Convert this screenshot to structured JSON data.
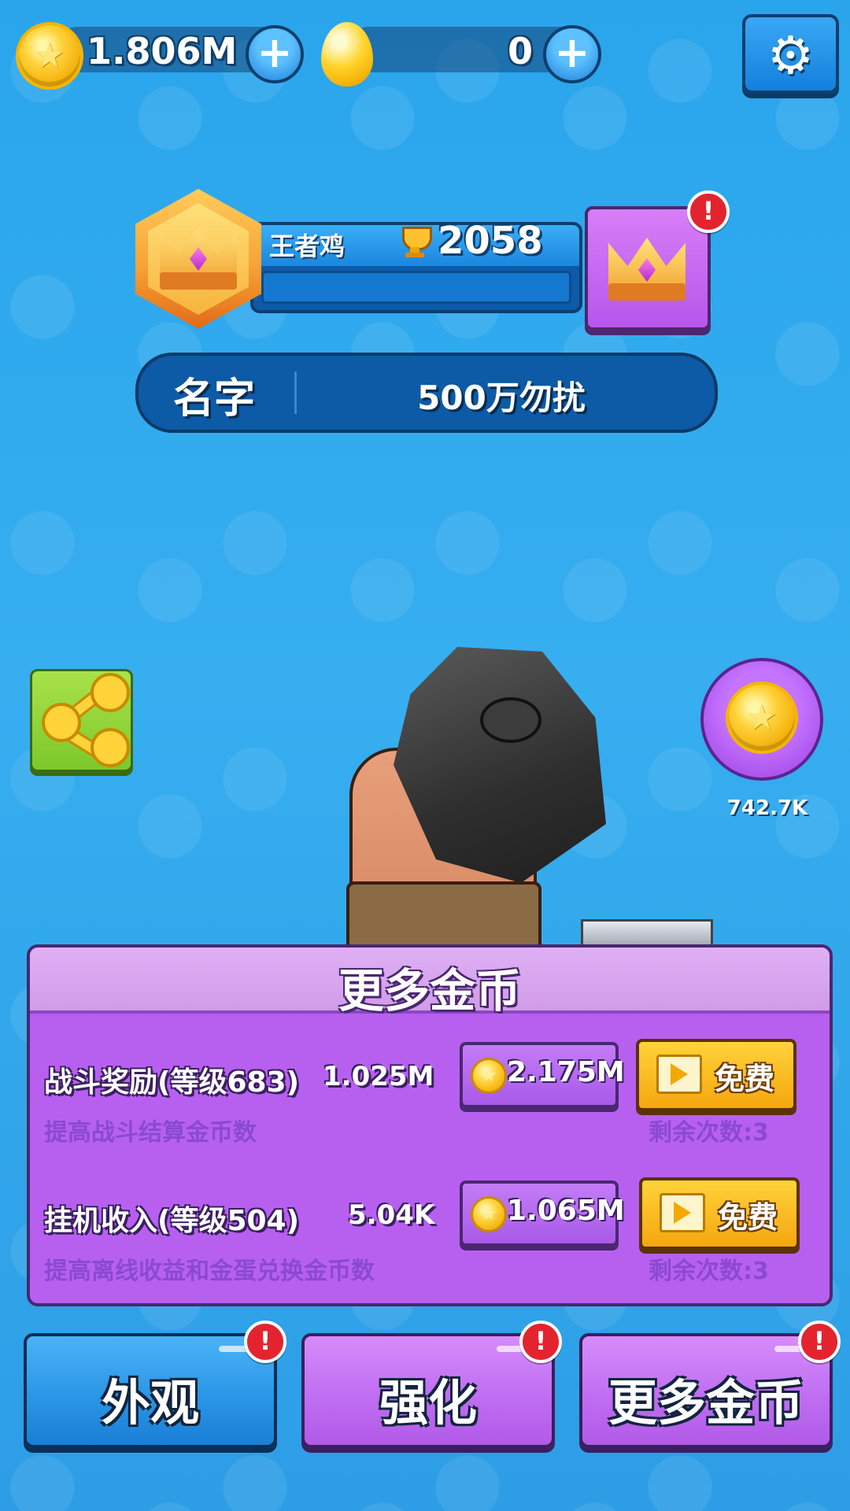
{
  "topbar": {
    "coins_value": "1.806M",
    "eggs_value": "0",
    "plus_symbol": "+",
    "settings_icon": "gear-icon",
    "gear_glyph": "⚙"
  },
  "profile": {
    "rank_title": "王者鸡",
    "trophies": "2058",
    "name_label": "名字",
    "name_value": "500万勿扰",
    "alert_mark": "!"
  },
  "side": {
    "share_icon": "share-icon",
    "bonus_coin_value": "742.7K",
    "coin_star": "★"
  },
  "panel": {
    "title": "更多金币",
    "upgrades": [
      {
        "title": "战斗奖励(等级683)",
        "current": "1.025M",
        "description": "提高战斗结算金币数",
        "cost": "2.175M",
        "free_label": "免费",
        "remaining": "剩余次数:3"
      },
      {
        "title": "挂机收入(等级504)",
        "current": "5.04K",
        "description": "提高离线收益和金蛋兑换金币数",
        "cost": "1.065M",
        "free_label": "免费",
        "remaining": "剩余次数:3"
      }
    ]
  },
  "nav": {
    "tabs": [
      {
        "label": "外观"
      },
      {
        "label": "强化"
      },
      {
        "label": "更多金币"
      }
    ]
  },
  "colors": {
    "background": "#2aa5ec",
    "panel_purple": "#b760f0",
    "free_yellow": "#ffd23a",
    "alert_red": "#e3242f"
  }
}
